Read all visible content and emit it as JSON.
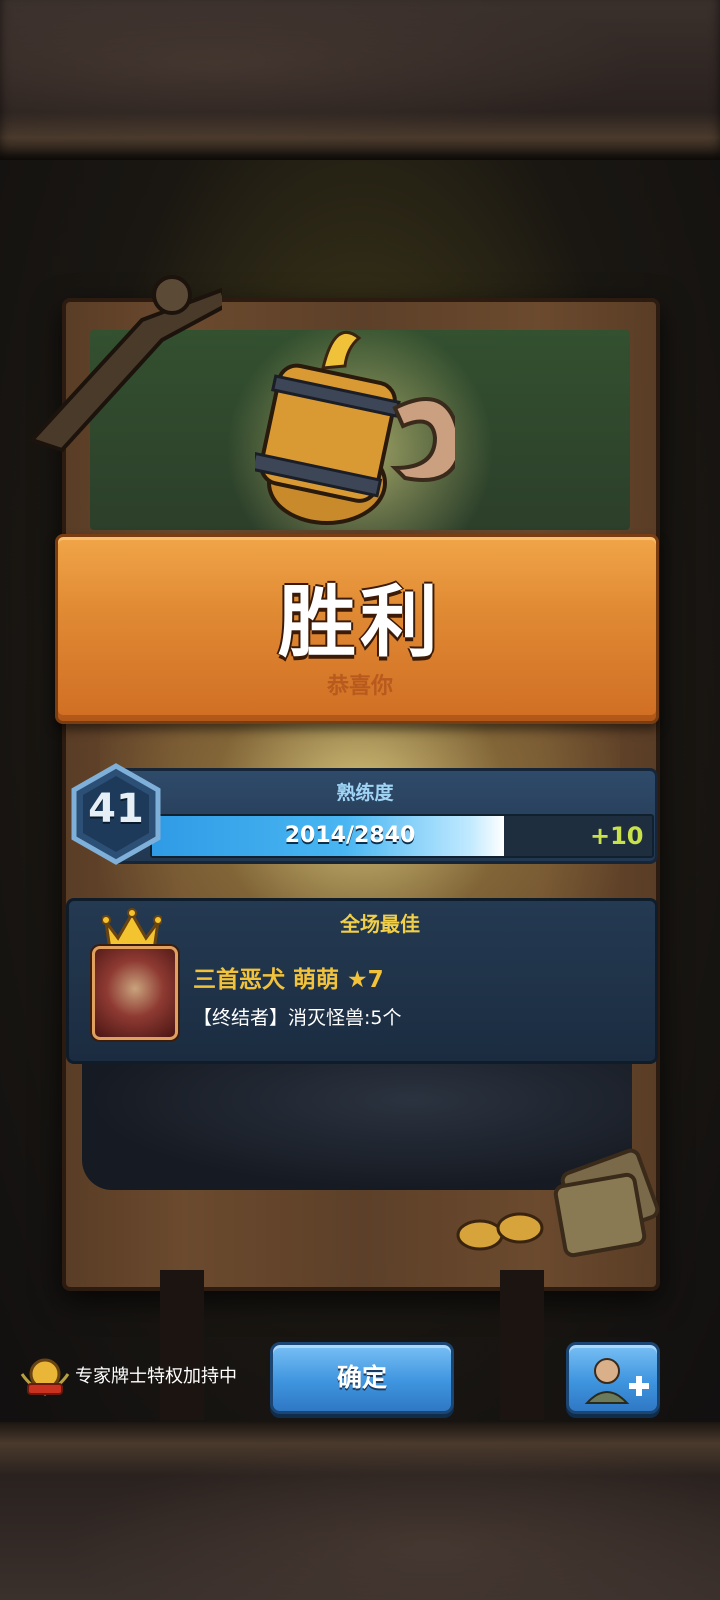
{
  "result": {
    "title": "胜利",
    "subtitle": "恭喜你"
  },
  "proficiency": {
    "label": "熟练度",
    "level": "41",
    "progress_text": "2014/2840",
    "progress_fraction": 0.709,
    "gain": "+10"
  },
  "mvp": {
    "label": "全场最佳",
    "unit_name": "三首恶犬 萌萌 ★7",
    "description": "【终结者】消灭怪兽:5个"
  },
  "footer": {
    "expert_status": "专家牌士特权加持中",
    "confirm_label": "确定"
  },
  "icons": {
    "level_badge": "hexagon-level-badge",
    "crown": "crown-icon",
    "expert": "expert-medal-icon",
    "invite": "add-friend-icon",
    "mug": "beer-mug-icon"
  },
  "colors": {
    "banner": "#e08a34",
    "accent_blue": "#3f95df",
    "gold": "#f2cf48",
    "gain": "#c9e24a"
  }
}
